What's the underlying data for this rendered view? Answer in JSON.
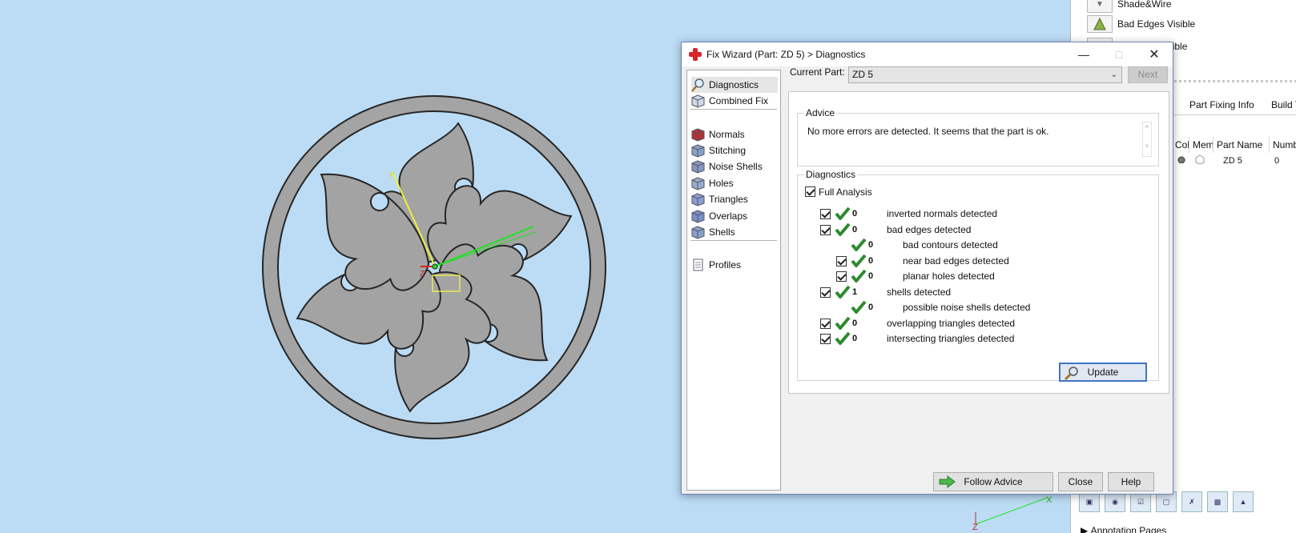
{
  "right_panel": {
    "rows": [
      {
        "label": "Shade&Wire",
        "icon": "shade-wire-icon"
      },
      {
        "label": "Bad Edges Visible",
        "icon": "bad-edges-icon"
      },
      {
        "label": "Triangles Visible",
        "icon": "triangles-visible-icon"
      }
    ],
    "tabs": [
      "Part Fixing Info",
      "Build T"
    ],
    "columns": [
      "Col",
      "Mem",
      "Part Name",
      "Numbe"
    ],
    "row": {
      "part_name": "ZD 5",
      "number": "0"
    },
    "annotation": "Annotation Pages"
  },
  "dialog": {
    "title": "Fix Wizard (Part: ZD 5) > Diagnostics",
    "nav": [
      {
        "label": "Diagnostics",
        "icon": "magnifier-icon"
      },
      {
        "label": "Combined Fix",
        "icon": "combined-fix-icon"
      },
      {
        "label": "Normals",
        "icon": "normals-icon"
      },
      {
        "label": "Stitching",
        "icon": "stitching-icon"
      },
      {
        "label": "Noise Shells",
        "icon": "noise-shells-icon"
      },
      {
        "label": "Holes",
        "icon": "holes-icon"
      },
      {
        "label": "Triangles",
        "icon": "triangles-icon"
      },
      {
        "label": "Overlaps",
        "icon": "overlaps-icon"
      },
      {
        "label": "Shells",
        "icon": "shells-icon"
      },
      {
        "label": "Profiles",
        "icon": "profiles-icon"
      }
    ],
    "current_part_label": "Current Part:",
    "current_part_value": "ZD 5",
    "next_label": "Next",
    "advice_title": "Advice",
    "advice_text": "No more errors are detected. It seems that the part is ok.",
    "diagnostics_title": "Diagnostics",
    "full_analysis_label": "Full Analysis",
    "items": [
      {
        "count": "0",
        "label": "inverted normals detected"
      },
      {
        "count": "0",
        "label": "bad edges detected"
      },
      {
        "count": "0",
        "label": "bad contours detected"
      },
      {
        "count": "0",
        "label": "near bad edges detected"
      },
      {
        "count": "0",
        "label": "planar holes detected"
      },
      {
        "count": "1",
        "label": "shells detected"
      },
      {
        "count": "0",
        "label": "possible noise shells detected"
      },
      {
        "count": "0",
        "label": "overlapping triangles detected"
      },
      {
        "count": "0",
        "label": "intersecting triangles detected"
      }
    ],
    "update_label": "Update",
    "follow_advice_label": "Follow Advice",
    "close_label": "Close",
    "help_label": "Help"
  },
  "viewport": {
    "axis_labels": {
      "y": "Y",
      "z": "Z",
      "x": "X"
    }
  },
  "colors": {
    "viewport_bg": "#bcdcf5",
    "part_fill": "#a3a3a3",
    "check_green": "#2e8b2e",
    "accent_blue": "#3d76c4"
  }
}
